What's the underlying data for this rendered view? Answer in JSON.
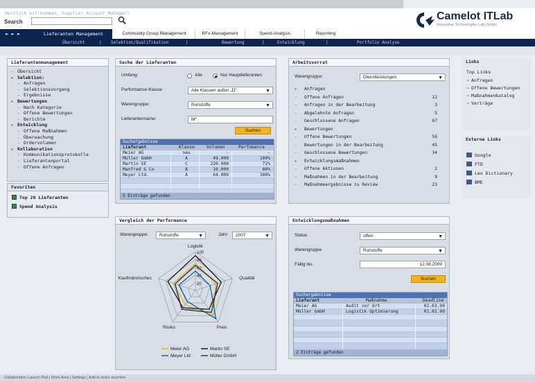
{
  "header": {
    "welcome": "Herzlich willkommen, Supplier Account Manager!",
    "search_label": "Search",
    "search_value": "",
    "brand": "Camelot ITLab",
    "tagline": "Innovative Technologies Lab GmbH"
  },
  "tabs": {
    "arrows": "► ► ►",
    "items": [
      "Lieferanten Management",
      "Commodity Group Management",
      "RFx-Management",
      "Spend-Analysis",
      "Reporting"
    ]
  },
  "subnav": [
    "Übersicht",
    "Selektion/Qualifikation",
    "Bewertung",
    "Entwicklung",
    "Portfolio Analyse"
  ],
  "sidebar": {
    "title": "Lieferantenmanagement",
    "items": [
      {
        "label": "Übersicht",
        "level": 0,
        "bullet": "-"
      },
      {
        "label": "Selektion:",
        "level": 1,
        "bullet": "▸"
      },
      {
        "label": "Anfragen",
        "level": 2,
        "bullet": "-"
      },
      {
        "label": "Selektionsvorgang",
        "level": 2,
        "bullet": "-"
      },
      {
        "label": "Ergebnisse",
        "level": 2,
        "bullet": "-"
      },
      {
        "label": "Bewertungen",
        "level": 1,
        "bullet": "▸"
      },
      {
        "label": "Nach Kategorie",
        "level": 2,
        "bullet": "-"
      },
      {
        "label": "Offene Bewertungen",
        "level": 2,
        "bullet": "-"
      },
      {
        "label": "Berichte",
        "level": 2,
        "bullet": "-"
      },
      {
        "label": "Entwicklung",
        "level": 1,
        "bullet": "▸"
      },
      {
        "label": "Offene Maßnahmen",
        "level": 2,
        "bullet": "-"
      },
      {
        "label": "Überwachung",
        "level": 2,
        "bullet": "-"
      },
      {
        "label": "Ordervolumen",
        "level": 2,
        "bullet": "-"
      },
      {
        "label": "Kollaboration",
        "level": 1,
        "bullet": "▸"
      },
      {
        "label": "Kommunikationsprotokolle",
        "level": 2,
        "bullet": "-"
      },
      {
        "label": "Lieferantenportal",
        "level": 2,
        "bullet": "-"
      },
      {
        "label": "Offene Anfragen",
        "level": 2,
        "bullet": "-"
      }
    ]
  },
  "favorites": {
    "title": "Favoriten",
    "items": [
      "Top 20 Lieferanten",
      "Spend Analysis"
    ]
  },
  "search_panel": {
    "title": "Suche der Lieferanten",
    "umfang_label": "Umfang:",
    "radio_all": "Alle",
    "radio_main": "Nur Hauptlieferanten",
    "performance_label": "Performance-Klasse",
    "performance_value": "Alle Klassen außer „D\"",
    "warengruppe_label": "Warengruppe:",
    "warengruppe_value": "Rohstoffe",
    "name_label": "Lieferantenname:",
    "name_value": "M*",
    "button": "Suchen",
    "results_title": "Suchergebnisse",
    "columns": [
      "Lieferant",
      "Klasse",
      "Volumen",
      "Perfomance"
    ],
    "rows": [
      [
        "Meier AG",
        "neu",
        "-",
        "-"
      ],
      [
        "Müller GmbH",
        "A",
        "49.000",
        "100%"
      ],
      [
        "Martin SE",
        "C",
        "220.000",
        "72%"
      ],
      [
        "Manfred & Co",
        "B",
        "10.000",
        "80%"
      ],
      [
        "Meyer Ltd.",
        "A",
        "64.000",
        "100%"
      ]
    ],
    "footer": "5 Einträge gefunden"
  },
  "workload": {
    "title": "Arbeitsvorrat",
    "warengruppe_label": "Warengruppe:",
    "warengruppe_value": "Dienstleistungen",
    "sections": [
      {
        "label": "Anfragen",
        "items": [
          [
            "Offene Anfragen",
            "12"
          ],
          [
            "Anfragen in der Bearbeitung",
            "3"
          ],
          [
            "Abgelehnte Anfragen",
            "5"
          ],
          [
            "Geschlossene Anfragen",
            "67"
          ]
        ]
      },
      {
        "label": "Bewertungen",
        "items": [
          [
            "Offene Bewertungen",
            "56"
          ],
          [
            "Bewertungen in der Bearbeitung",
            "45"
          ],
          [
            "Geschlossene Bewertungen",
            "34"
          ]
        ]
      },
      {
        "label": "Entwicklungsmaßnahmen",
        "items": [
          [
            "Offene Aktionen",
            "2"
          ],
          [
            "Maßnahmen in der Bearbeitung",
            "9"
          ],
          [
            "Maßnahmeergebnisse zu Review",
            "23"
          ]
        ]
      }
    ]
  },
  "links": {
    "title": "Links",
    "subtitle": "Top Links",
    "items": [
      "Anfragen",
      "Offene Bewertungen",
      "Maßnahmenkatalog",
      "Verträge"
    ]
  },
  "ext_links": {
    "title": "Externe Links",
    "items": [
      "Google",
      "FTD",
      "Leo Dictionary",
      "BME"
    ]
  },
  "performance": {
    "title": "Vergleich der Performance",
    "warengruppe_label": "Warengruppe:",
    "warengruppe_value": "Rohstoffe",
    "jahr_label": "Jahr:",
    "jahr_value": "2007",
    "axes": [
      "Logistik",
      "Qualität",
      "Preis",
      "Risiko",
      "Kaufmännisches"
    ],
    "ticks": [
      "100",
      "80",
      "60",
      "40",
      "20"
    ],
    "legend": [
      "Meier AG",
      "Martin SE",
      "Meyer Ltd",
      "Müller GmbH"
    ]
  },
  "chart_data": {
    "type": "radar",
    "categories": [
      "Logistik",
      "Qualität",
      "Preis",
      "Risiko",
      "Kaufmännisches"
    ],
    "ylim": [
      0,
      100
    ],
    "series": [
      {
        "name": "Meier AG",
        "values": [
          70,
          55,
          80,
          45,
          60
        ],
        "color": "#e8b422"
      },
      {
        "name": "Martin SE",
        "values": [
          90,
          70,
          60,
          55,
          75
        ],
        "color": "#1a1a1a"
      },
      {
        "name": "Meyer Ltd",
        "values": [
          50,
          40,
          90,
          35,
          45
        ],
        "color": "#0b6a8e"
      },
      {
        "name": "Müller GmbH",
        "values": [
          65,
          60,
          70,
          60,
          55
        ],
        "color": "#333333"
      }
    ]
  },
  "development": {
    "title": "Entwicklungsmaßnahmen",
    "status_label": "Status",
    "status_value": "offen",
    "warengruppe_label": "Warengruppe",
    "warengruppe_value": "Rohstoffe",
    "faellig_label": "Fällig bis",
    "faellig_value": "12.08.2009",
    "button": "Suchen",
    "results_title": "Suchergebnisse",
    "columns": [
      "Lieferant",
      "Maßnahme",
      "Deadline"
    ],
    "rows": [
      [
        "Meier AG",
        "Audit vor Ort",
        "02.03.09"
      ],
      [
        "Müller GmbH",
        "Logistik Optimierung",
        "01.01.09"
      ]
    ],
    "footer": "2 Einträge gefunden"
  },
  "statusbar": "Collaboration Launch Pad | Work Area | Settings | Add to entire favorites"
}
